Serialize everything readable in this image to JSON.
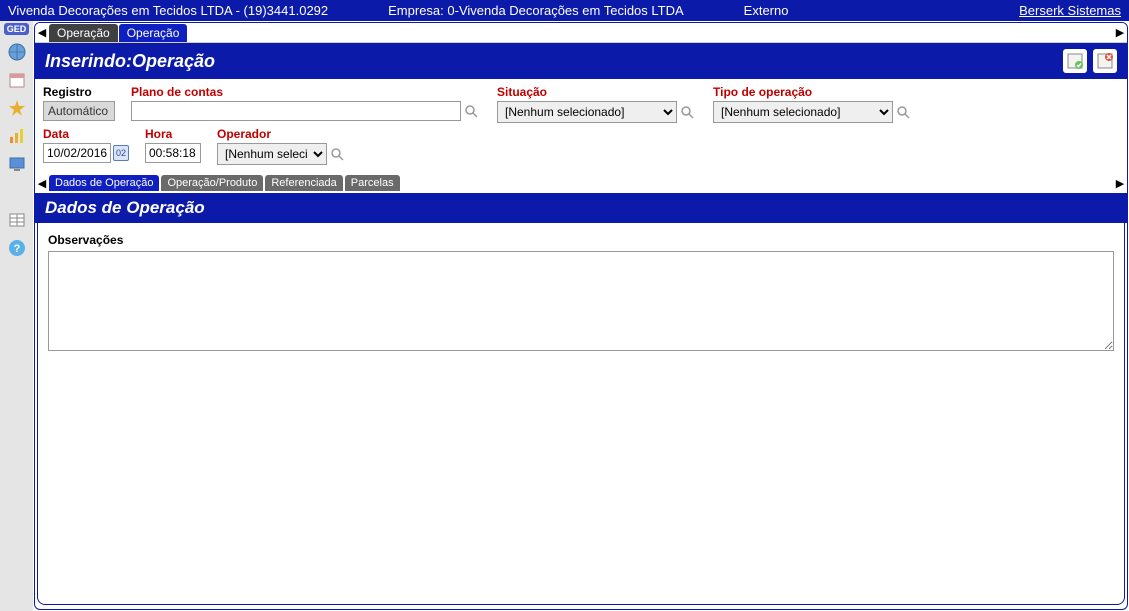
{
  "header": {
    "title": "Vivenda Decorações em Tecidos LTDA - (19)3441.0292",
    "company": "Empresa: 0-Vivenda Decorações em Tecidos LTDA",
    "externo": "Externo",
    "link": "Berserk Sistemas"
  },
  "sidebar": {
    "ged": "GED"
  },
  "tabs": {
    "items": [
      {
        "label": "Operação",
        "style": "dark"
      },
      {
        "label": "Operação",
        "style": "active"
      }
    ]
  },
  "page": {
    "title": "Inserindo:Operação"
  },
  "form": {
    "registro": {
      "label": "Registro",
      "value": "Automático"
    },
    "plano": {
      "label": "Plano de contas",
      "value": ""
    },
    "situacao": {
      "label": "Situação",
      "selected": "[Nenhum selecionado]"
    },
    "tipo": {
      "label": "Tipo de operação",
      "selected": "[Nenhum selecionado]"
    },
    "data": {
      "label": "Data",
      "value": "10/02/2016"
    },
    "hora": {
      "label": "Hora",
      "value": "00:58:18"
    },
    "operador": {
      "label": "Operador",
      "selected": "[Nenhum selecio"
    }
  },
  "subtabs": {
    "items": [
      {
        "label": "Dados de Operação",
        "active": true
      },
      {
        "label": "Operação/Produto",
        "active": false
      },
      {
        "label": "Referenciada",
        "active": false
      },
      {
        "label": "Parcelas",
        "active": false
      }
    ]
  },
  "section": {
    "title": "Dados de Operação",
    "obs_label": "Observações",
    "obs_value": ""
  }
}
